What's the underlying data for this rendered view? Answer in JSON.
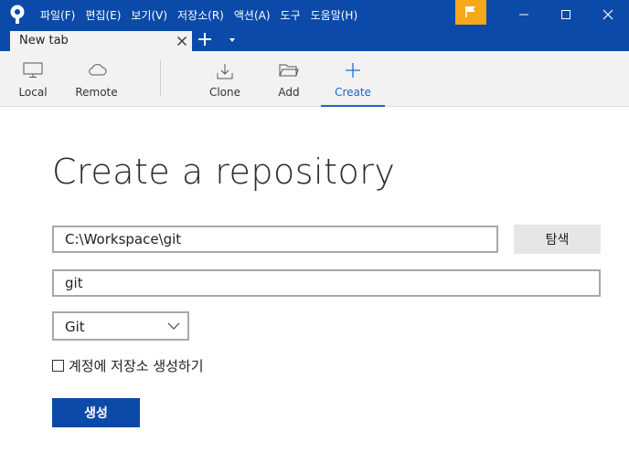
{
  "menu": [
    "파일(F)",
    "편집(E)",
    "보기(V)",
    "저장소(R)",
    "액션(A)",
    "도구",
    "도움말(H)"
  ],
  "tab": {
    "label": "New tab"
  },
  "toolbar": {
    "local": "Local",
    "remote": "Remote",
    "clone": "Clone",
    "add": "Add",
    "create": "Create"
  },
  "main": {
    "heading": "Create a repository",
    "path_value": "C:\\Workspace\\git",
    "browse_label": "탐색",
    "name_value": "git",
    "vcs_selected": "Git",
    "checkbox_label": "계정에 저장소 생성하기",
    "checkbox_checked": false,
    "create_label": "생성"
  },
  "colors": {
    "brand": "#0b4aa8",
    "accent": "#1c66c8",
    "flag": "#f7a81a"
  },
  "icons": {
    "app": "sourcetree-logo-icon",
    "flag": "flag-icon",
    "local": "monitor-icon",
    "remote": "cloud-icon",
    "clone": "download-icon",
    "add": "folder-icon",
    "create": "plus-icon"
  }
}
